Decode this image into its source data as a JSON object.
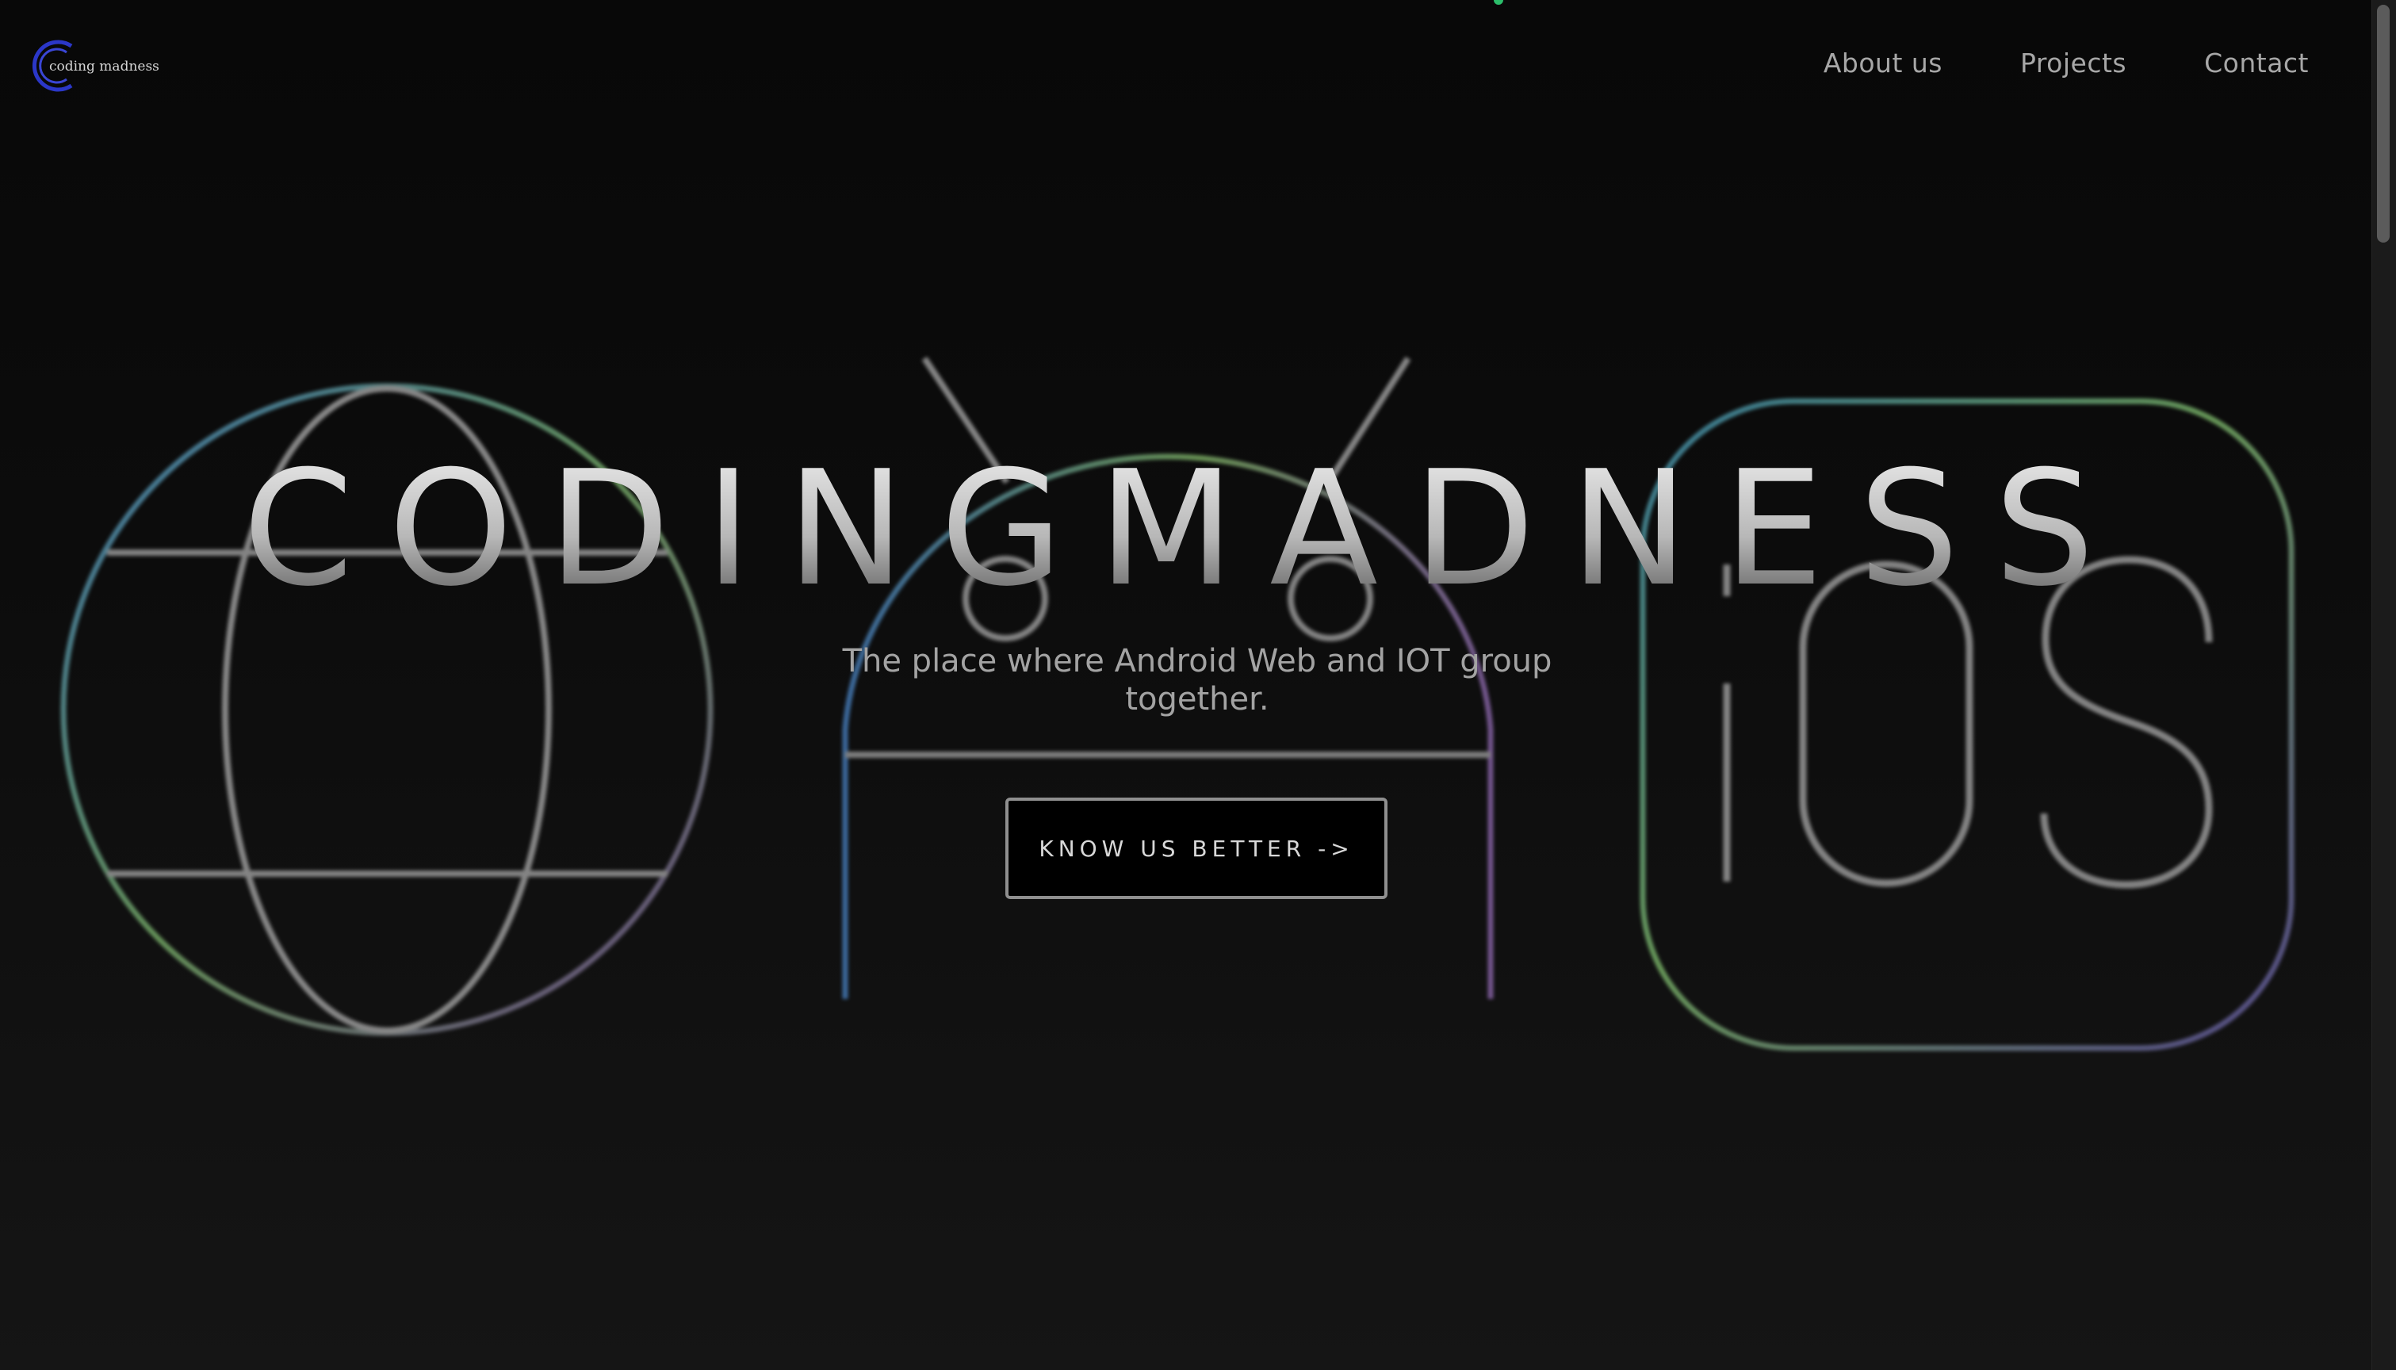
{
  "logo": {
    "text": "coding madness",
    "icon": "logo-c-icon",
    "color": "#2a37c9"
  },
  "nav": {
    "items": [
      {
        "label": "About us"
      },
      {
        "label": "Projects"
      },
      {
        "label": "Contact"
      }
    ]
  },
  "hero": {
    "title": "CODINGMADNESS",
    "subtitle": "The place where Android Web and IOT group together.",
    "cta_label": "KNOW US BETTER ->"
  },
  "backdrop": {
    "icons": [
      "globe-icon",
      "android-icon",
      "ios-icon"
    ],
    "ios_text": "iOS"
  },
  "colors": {
    "background": "#0b0b0b",
    "text_muted": "#a7a7a7",
    "glow_blue": "#3c6fa8",
    "glow_green": "#7ba35a",
    "glow_purple": "#6a4e86"
  }
}
